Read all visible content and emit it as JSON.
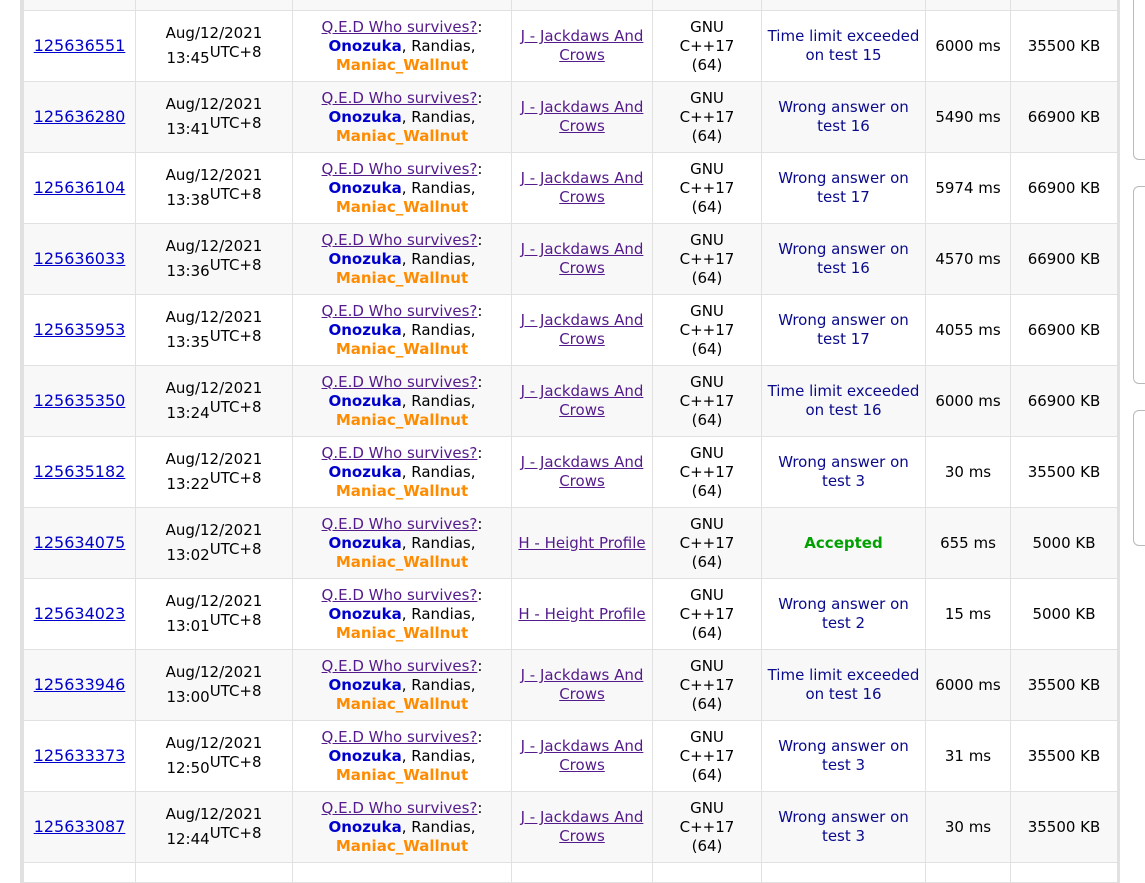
{
  "rows": [
    {
      "id": "125636551",
      "date": "Aug/12/2021",
      "time": "13:45",
      "tz": "UTC+8",
      "party": "Q.E.D Who survives?",
      "m1": "Onozuka",
      "m2": "Randias",
      "m3": "Maniac_Wallnut",
      "problem": "J - Jackdaws And Crows",
      "lang": [
        "GNU",
        "C++17",
        "(64)"
      ],
      "verdict": "Time limit exceeded on test 15",
      "status": "wrong",
      "time_used": "6000 ms",
      "memory": "35500 KB"
    },
    {
      "id": "125636280",
      "date": "Aug/12/2021",
      "time": "13:41",
      "tz": "UTC+8",
      "party": "Q.E.D Who survives?",
      "m1": "Onozuka",
      "m2": "Randias",
      "m3": "Maniac_Wallnut",
      "problem": "J - Jackdaws And Crows",
      "lang": [
        "GNU",
        "C++17",
        "(64)"
      ],
      "verdict": "Wrong answer on test 16",
      "status": "wrong",
      "time_used": "5490 ms",
      "memory": "66900 KB"
    },
    {
      "id": "125636104",
      "date": "Aug/12/2021",
      "time": "13:38",
      "tz": "UTC+8",
      "party": "Q.E.D Who survives?",
      "m1": "Onozuka",
      "m2": "Randias",
      "m3": "Maniac_Wallnut",
      "problem": "J - Jackdaws And Crows",
      "lang": [
        "GNU",
        "C++17",
        "(64)"
      ],
      "verdict": "Wrong answer on test 17",
      "status": "wrong",
      "time_used": "5974 ms",
      "memory": "66900 KB"
    },
    {
      "id": "125636033",
      "date": "Aug/12/2021",
      "time": "13:36",
      "tz": "UTC+8",
      "party": "Q.E.D Who survives?",
      "m1": "Onozuka",
      "m2": "Randias",
      "m3": "Maniac_Wallnut",
      "problem": "J - Jackdaws And Crows",
      "lang": [
        "GNU",
        "C++17",
        "(64)"
      ],
      "verdict": "Wrong answer on test 16",
      "status": "wrong",
      "time_used": "4570 ms",
      "memory": "66900 KB"
    },
    {
      "id": "125635953",
      "date": "Aug/12/2021",
      "time": "13:35",
      "tz": "UTC+8",
      "party": "Q.E.D Who survives?",
      "m1": "Onozuka",
      "m2": "Randias",
      "m3": "Maniac_Wallnut",
      "problem": "J - Jackdaws And Crows",
      "lang": [
        "GNU",
        "C++17",
        "(64)"
      ],
      "verdict": "Wrong answer on test 17",
      "status": "wrong",
      "time_used": "4055 ms",
      "memory": "66900 KB"
    },
    {
      "id": "125635350",
      "date": "Aug/12/2021",
      "time": "13:24",
      "tz": "UTC+8",
      "party": "Q.E.D Who survives?",
      "m1": "Onozuka",
      "m2": "Randias",
      "m3": "Maniac_Wallnut",
      "problem": "J - Jackdaws And Crows",
      "lang": [
        "GNU",
        "C++17",
        "(64)"
      ],
      "verdict": "Time limit exceeded on test 16",
      "status": "wrong",
      "time_used": "6000 ms",
      "memory": "66900 KB"
    },
    {
      "id": "125635182",
      "date": "Aug/12/2021",
      "time": "13:22",
      "tz": "UTC+8",
      "party": "Q.E.D Who survives?",
      "m1": "Onozuka",
      "m2": "Randias",
      "m3": "Maniac_Wallnut",
      "problem": "J - Jackdaws And Crows",
      "lang": [
        "GNU",
        "C++17",
        "(64)"
      ],
      "verdict": "Wrong answer on test 3",
      "status": "wrong",
      "time_used": "30 ms",
      "memory": "35500 KB"
    },
    {
      "id": "125634075",
      "date": "Aug/12/2021",
      "time": "13:02",
      "tz": "UTC+8",
      "party": "Q.E.D Who survives?",
      "m1": "Onozuka",
      "m2": "Randias",
      "m3": "Maniac_Wallnut",
      "problem": "H - Height Profile",
      "lang": [
        "GNU",
        "C++17",
        "(64)"
      ],
      "verdict": "Accepted",
      "status": "ok",
      "time_used": "655 ms",
      "memory": "5000 KB"
    },
    {
      "id": "125634023",
      "date": "Aug/12/2021",
      "time": "13:01",
      "tz": "UTC+8",
      "party": "Q.E.D Who survives?",
      "m1": "Onozuka",
      "m2": "Randias",
      "m3": "Maniac_Wallnut",
      "problem": "H - Height Profile",
      "lang": [
        "GNU",
        "C++17",
        "(64)"
      ],
      "verdict": "Wrong answer on test 2",
      "status": "wrong",
      "time_used": "15 ms",
      "memory": "5000 KB"
    },
    {
      "id": "125633946",
      "date": "Aug/12/2021",
      "time": "13:00",
      "tz": "UTC+8",
      "party": "Q.E.D Who survives?",
      "m1": "Onozuka",
      "m2": "Randias",
      "m3": "Maniac_Wallnut",
      "problem": "J - Jackdaws And Crows",
      "lang": [
        "GNU",
        "C++17",
        "(64)"
      ],
      "verdict": "Time limit exceeded on test 16",
      "status": "wrong",
      "time_used": "6000 ms",
      "memory": "35500 KB"
    },
    {
      "id": "125633373",
      "date": "Aug/12/2021",
      "time": "12:50",
      "tz": "UTC+8",
      "party": "Q.E.D Who survives?",
      "m1": "Onozuka",
      "m2": "Randias",
      "m3": "Maniac_Wallnut",
      "problem": "J - Jackdaws And Crows",
      "lang": [
        "GNU",
        "C++17",
        "(64)"
      ],
      "verdict": "Wrong answer on test 3",
      "status": "wrong",
      "time_used": "31 ms",
      "memory": "35500 KB"
    },
    {
      "id": "125633087",
      "date": "Aug/12/2021",
      "time": "12:44",
      "tz": "UTC+8",
      "party": "Q.E.D Who survives?",
      "m1": "Onozuka",
      "m2": "Randias",
      "m3": "Maniac_Wallnut",
      "problem": "J - Jackdaws And Crows",
      "lang": [
        "GNU",
        "C++17",
        "(64)"
      ],
      "verdict": "Wrong answer on test 3",
      "status": "wrong",
      "time_used": "30 ms",
      "memory": "35500 KB"
    }
  ],
  "colors": {
    "link": "#0000cc",
    "visited": "#551a8b",
    "orange": "#ff8c00",
    "accepted": "#00a000",
    "verdict": "#0a0a8c",
    "border": "#e1e1e1",
    "stripe": "#f8f8f8"
  }
}
